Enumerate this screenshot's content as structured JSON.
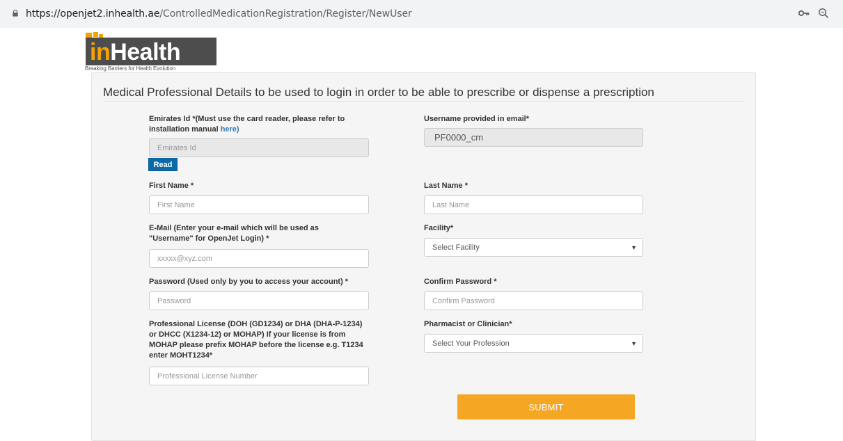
{
  "browser": {
    "url_host": "https://openjet2.inhealth.ae",
    "url_path": "/ControlledMedicationRegistration/Register/NewUser"
  },
  "logo": {
    "prefix": "in",
    "name": "Health",
    "tagline": "Breaking Barriers for Health Evolution"
  },
  "form": {
    "title": "Medical Professional Details to be used to login in order to be able to prescribe or dispense a prescription",
    "emirates_id": {
      "label": "Emirates Id *(Must use the card reader, please refer to installation manual ",
      "link": "here)",
      "placeholder": "Emirates Id",
      "read_button": "Read"
    },
    "username": {
      "label": "Username provided in email*",
      "value": "PF0000_cm"
    },
    "first_name": {
      "label": "First Name *",
      "placeholder": "First Name"
    },
    "last_name": {
      "label": "Last Name *",
      "placeholder": "Last Name"
    },
    "email": {
      "label": "E-Mail (Enter your e-mail which will be used as \"Username\" for OpenJet Login) *",
      "placeholder": "xxxxx@xyz.com"
    },
    "facility": {
      "label": "Facility*",
      "selected": "Select Facility"
    },
    "password": {
      "label": "Password (Used only by you to access your account) *",
      "placeholder": "Password"
    },
    "confirm_password": {
      "label": "Confirm Password *",
      "placeholder": "Confirm Password"
    },
    "license": {
      "label": "Professional License (DOH (GD1234) or DHA (DHA-P-1234) or DHCC (X1234-12) or MOHAP) If your license is from MOHAP please prefix MOHAP before the license e.g. T1234 enter MOHT1234*",
      "placeholder": "Professional License Number"
    },
    "profession": {
      "label": "Pharmacist or Clinician*",
      "selected": "Select Your Profession"
    },
    "submit_label": "SUBMIT"
  },
  "colors": {
    "brand_orange": "#f5a300",
    "submit_orange": "#f5a623",
    "read_blue": "#0b6aa8"
  },
  "icons": [
    "lock-icon",
    "key-icon",
    "zoom-icon",
    "caret-down-icon"
  ]
}
